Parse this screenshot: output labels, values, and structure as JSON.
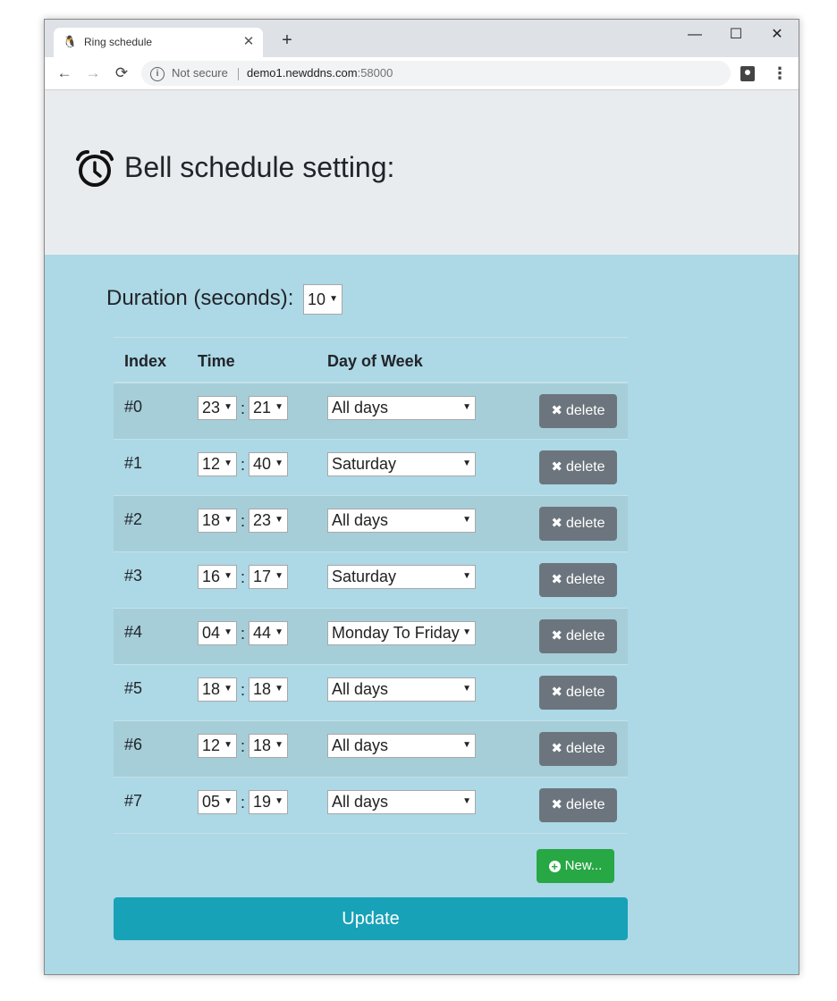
{
  "browser": {
    "tab_title": "Ring schedule",
    "tab_favicon": "penguin-icon",
    "close_tab_glyph": "✕",
    "new_tab_glyph": "+",
    "minimize_glyph": "—",
    "maximize_glyph": "☐",
    "close_window_glyph": "✕",
    "back_glyph": "←",
    "forward_glyph": "→",
    "reload_glyph": "⟳",
    "info_glyph": "i",
    "security_text": "Not secure",
    "url_host": "demo1.newddns.com",
    "url_port": ":58000",
    "menu_glyph": "⋮"
  },
  "page": {
    "title": "Bell schedule setting:",
    "duration_label": "Duration (seconds):",
    "duration_value": "10",
    "headers": {
      "index": "Index",
      "time": "Time",
      "day": "Day of Week"
    },
    "colon": ":",
    "delete_label": "delete",
    "delete_glyph": "✖",
    "new_label": "New...",
    "new_glyph": "+",
    "update_label": "Update",
    "arrow_glyph": "▼"
  },
  "rows": [
    {
      "index": "#0",
      "hour": "23",
      "minute": "21",
      "day": "All days"
    },
    {
      "index": "#1",
      "hour": "12",
      "minute": "40",
      "day": "Saturday"
    },
    {
      "index": "#2",
      "hour": "18",
      "minute": "23",
      "day": "All days"
    },
    {
      "index": "#3",
      "hour": "16",
      "minute": "17",
      "day": "Saturday"
    },
    {
      "index": "#4",
      "hour": "04",
      "minute": "44",
      "day": "Monday To Friday"
    },
    {
      "index": "#5",
      "hour": "18",
      "minute": "18",
      "day": "All days"
    },
    {
      "index": "#6",
      "hour": "12",
      "minute": "18",
      "day": "All days"
    },
    {
      "index": "#7",
      "hour": "05",
      "minute": "19",
      "day": "All days"
    }
  ],
  "colors": {
    "page_bg": "#add8e6",
    "stripe": "#a5ced9",
    "jumbotron": "#e9ecef",
    "delete_btn": "#6c757d",
    "new_btn": "#28a745",
    "update_btn": "#17a2b8"
  }
}
